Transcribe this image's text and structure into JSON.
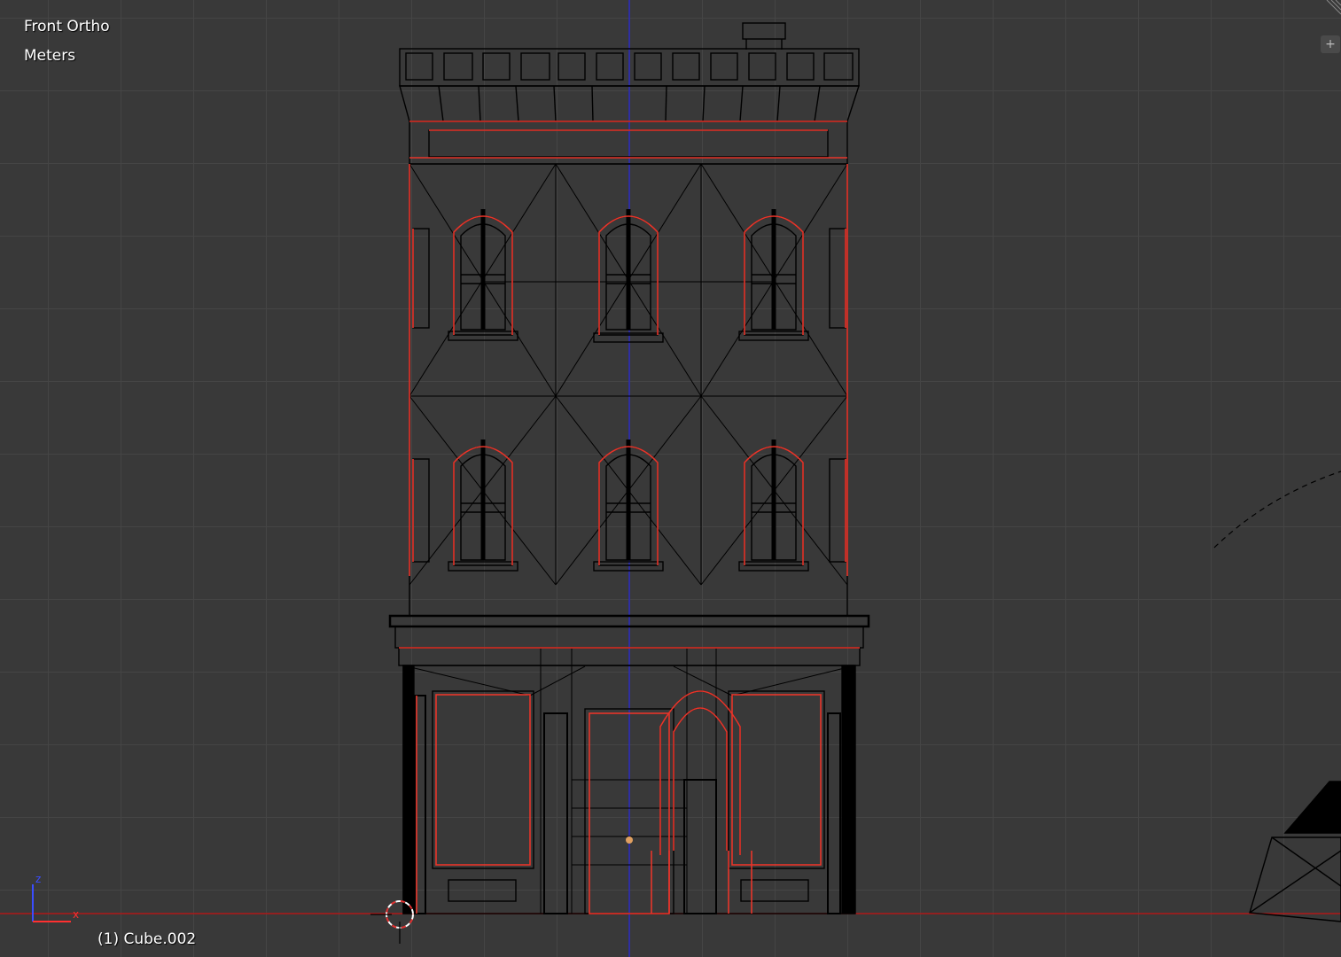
{
  "viewport": {
    "view_name": "Front Ortho",
    "units": "Meters",
    "object_info": "(1) Cube.002"
  },
  "axes": {
    "z_label": "z",
    "x_label": "x",
    "z_color": "#3a4dff",
    "x_color": "#ff3030"
  },
  "colors": {
    "background": "#393939",
    "grid": "#454545",
    "wire": "#000000",
    "selected_wire": "#e8352a",
    "ground_line": "#b01818",
    "center_line": "#2a2ac0",
    "origin_dot": "#e0a060"
  },
  "icons": {
    "split": "plus-icon",
    "cursor": "3d-cursor-icon",
    "gizmo": "axis-gizmo-icon"
  }
}
